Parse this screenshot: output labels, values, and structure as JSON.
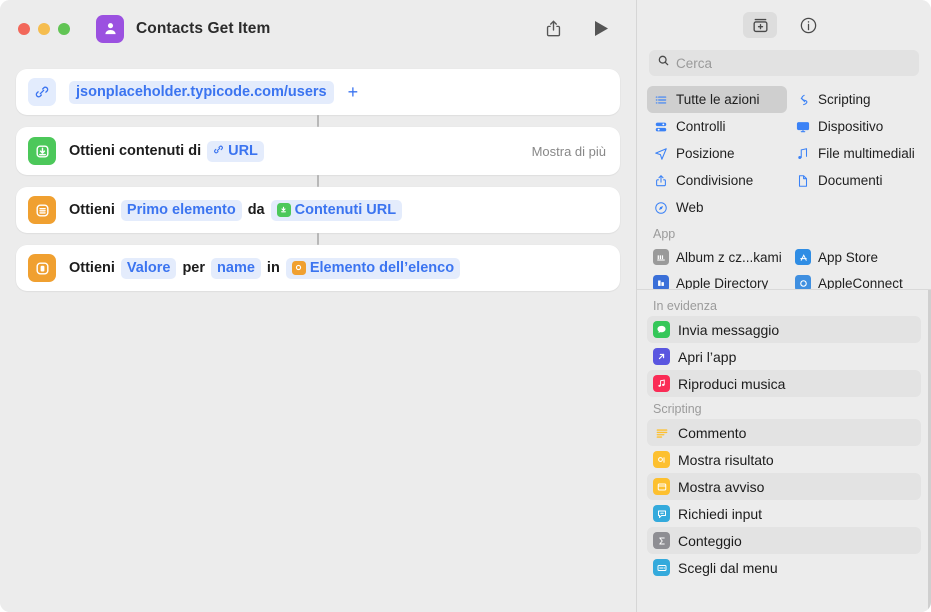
{
  "window": {
    "title": "Contacts Get Item",
    "app_icon": "contacts-person-icon",
    "traffic_lights": [
      "close",
      "minimize",
      "zoom"
    ],
    "toolbar": {
      "share_label": "share-icon",
      "run_label": "play-icon"
    }
  },
  "editor": {
    "cards": [
      {
        "id": "url-action",
        "icon": "link-icon",
        "icon_style": "lightblue",
        "tokens": [
          {
            "type": "pill",
            "text": "jsonplaceholder.typicode.com/users"
          }
        ],
        "plus": "+"
      },
      {
        "id": "get-contents-of-url",
        "icon": "download-icon",
        "icon_style": "green",
        "tokens": [
          {
            "type": "word",
            "text": "Ottieni contenuti di"
          },
          {
            "type": "pill",
            "text": "URL",
            "glyph": "link"
          }
        ],
        "trailing": "Mostra di più"
      },
      {
        "id": "get-item-from-list",
        "icon": "list-icon",
        "icon_style": "orange",
        "tokens": [
          {
            "type": "word",
            "text": "Ottieni"
          },
          {
            "type": "pill",
            "text": "Primo elemento"
          },
          {
            "type": "word",
            "text": "da"
          },
          {
            "type": "pill",
            "text": "Contenuti URL",
            "glyph": "green-square"
          }
        ]
      },
      {
        "id": "get-dictionary-value",
        "icon": "dictionary-icon",
        "icon_style": "orange",
        "tokens": [
          {
            "type": "word",
            "text": "Ottieni"
          },
          {
            "type": "pill",
            "text": "Valore"
          },
          {
            "type": "word",
            "text": "per"
          },
          {
            "type": "pill",
            "text": "name"
          },
          {
            "type": "word",
            "text": "in"
          },
          {
            "type": "pill",
            "text": "Elemento dell’elenco",
            "glyph": "orange-square"
          }
        ]
      }
    ]
  },
  "library": {
    "toolbar": {
      "actions_library_icon": "actions-library-icon",
      "info_icon": "info-icon"
    },
    "search": {
      "placeholder": "Cerca",
      "value": "",
      "icon": "search-icon"
    },
    "categories": [
      {
        "label": "Tutte le azioni",
        "icon": "list-bullets-icon",
        "selected": true
      },
      {
        "label": "Scripting",
        "icon": "scripting-icon",
        "selected": false
      },
      {
        "label": "Controlli",
        "icon": "controls-icon",
        "selected": false
      },
      {
        "label": "Dispositivo",
        "icon": "device-icon",
        "selected": false
      },
      {
        "label": "Posizione",
        "icon": "location-icon",
        "selected": false
      },
      {
        "label": "File multimediali",
        "icon": "media-icon",
        "selected": false
      },
      {
        "label": "Condivisione",
        "icon": "share-icon",
        "selected": false
      },
      {
        "label": "Documenti",
        "icon": "documents-icon",
        "selected": false
      },
      {
        "label": "Web",
        "icon": "web-icon",
        "selected": false
      }
    ],
    "apps_section": {
      "header": "App",
      "items": [
        {
          "label": "Album z cz...kami",
          "icon_color": "#9a9a9a"
        },
        {
          "label": "App Store",
          "icon_color": "#2f8de4"
        },
        {
          "label": "Apple Directory",
          "icon_color": "#3a6fd8"
        },
        {
          "label": "AppleConnect",
          "icon_color": "#3f8fe0"
        }
      ]
    },
    "featured_section": {
      "header": "In evidenza",
      "items": [
        {
          "label": "Invia messaggio",
          "icon_color": "#35c759",
          "alt": true
        },
        {
          "label": "Apri l’app",
          "icon_color": "#5a56e0",
          "alt": false
        },
        {
          "label": "Riproduci musica",
          "icon_color": "#fa2c56",
          "alt": true
        }
      ]
    },
    "scripting_section": {
      "header": "Scripting",
      "items": [
        {
          "label": "Commento",
          "icon_color": "#fdc02f",
          "alt": true
        },
        {
          "label": "Mostra risultato",
          "icon_color": "#fdc02f",
          "alt": false
        },
        {
          "label": "Mostra avviso",
          "icon_color": "#fdc02f",
          "alt": true
        },
        {
          "label": "Richiedi input",
          "icon_color": "#34aadc",
          "alt": false
        },
        {
          "label": "Conteggio",
          "icon_color": "#8e8e93",
          "alt": true
        },
        {
          "label": "Scegli dal menu",
          "icon_color": "#34aadc",
          "alt": false
        }
      ]
    }
  },
  "colors": {
    "accent_blue": "#3b74f0",
    "green": "#4cc85a",
    "orange": "#f0a030",
    "purple": "#9b51e0",
    "window_bg": "#ececec"
  }
}
